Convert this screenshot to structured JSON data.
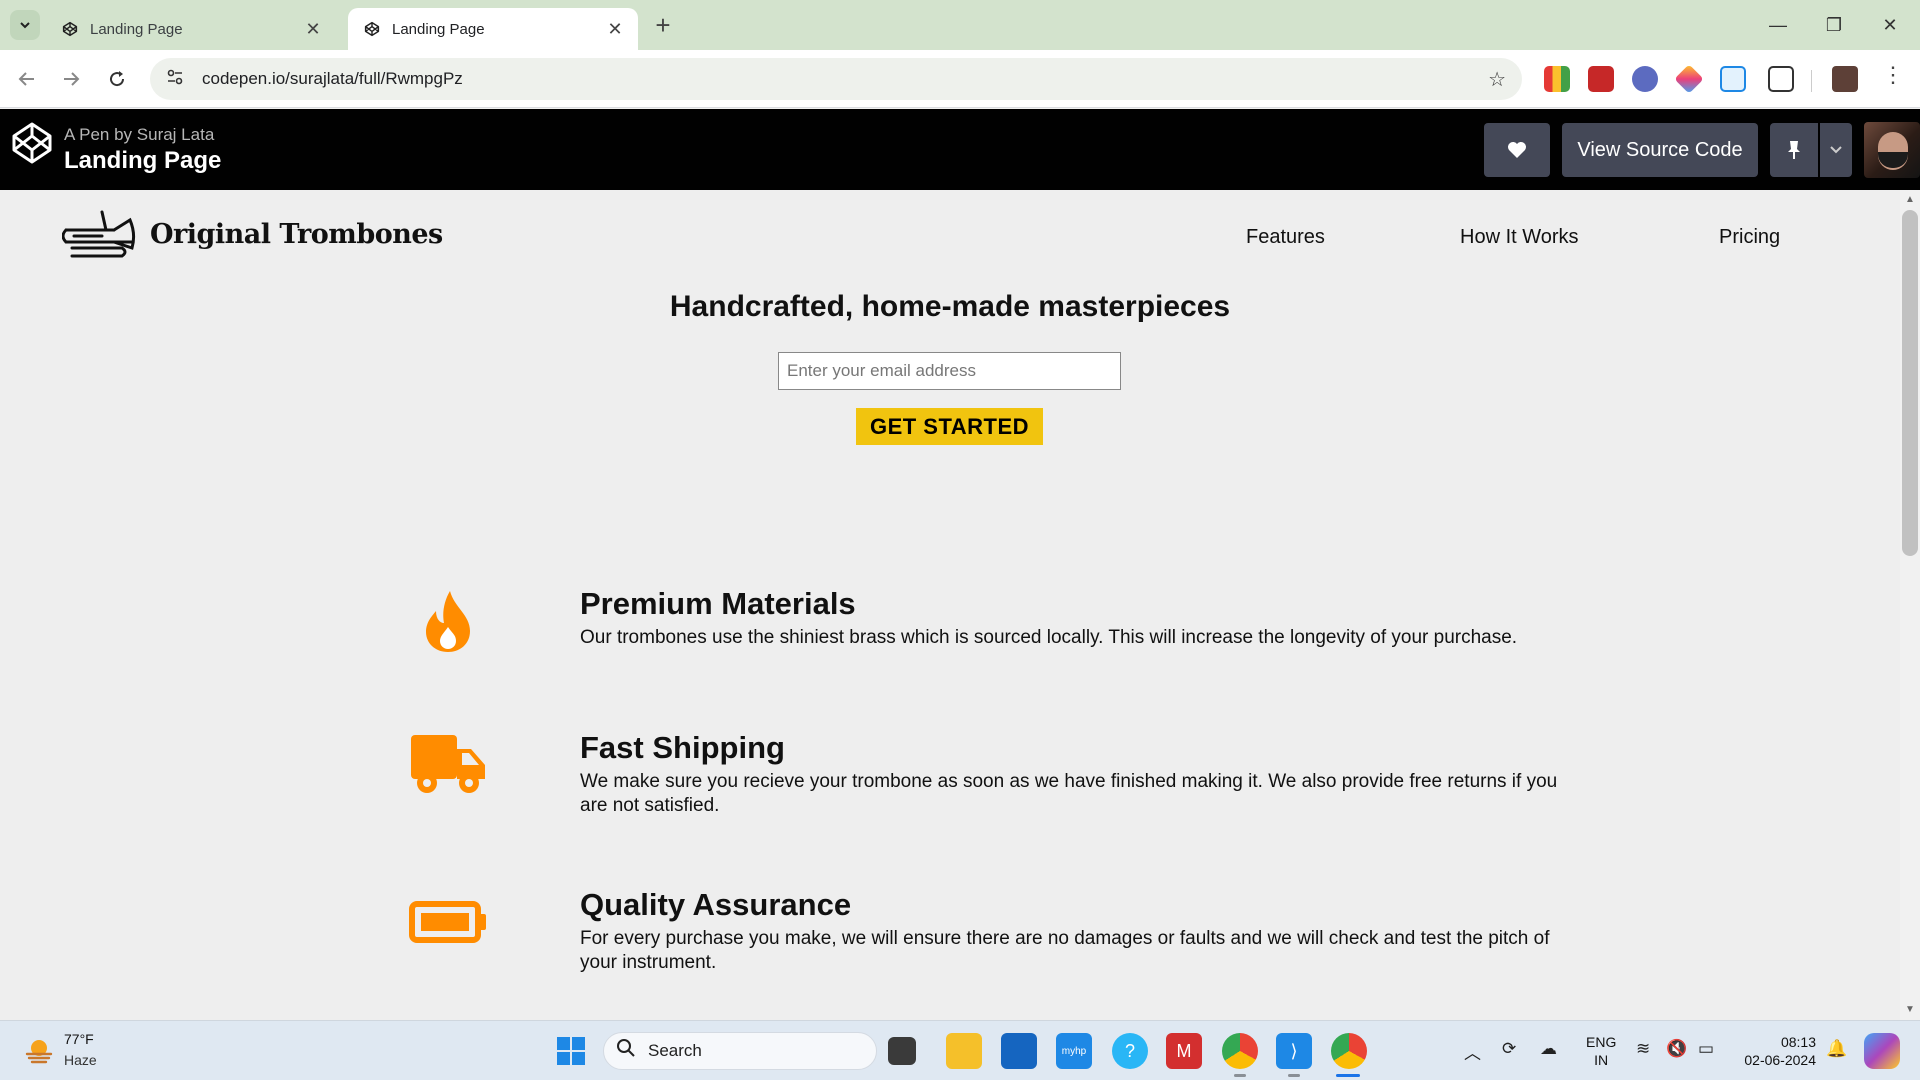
{
  "browser": {
    "tabs": [
      {
        "title": "Landing Page",
        "close": "✕"
      },
      {
        "title": "Landing Page",
        "close": "✕"
      }
    ],
    "new_tab": "+",
    "url": "codepen.io/surajlata/full/RwmpgPz",
    "window_controls": {
      "minimize": "—",
      "restore": "❐",
      "close": "✕"
    }
  },
  "codepen": {
    "byline": "A Pen by Suraj Lata",
    "title": "Landing Page",
    "view_source_label": "View Source Code",
    "heart_icon": "heart-icon",
    "pin_icon": "pin-icon"
  },
  "site": {
    "brand": "Original Trombones",
    "nav": [
      "Features",
      "How It Works",
      "Pricing"
    ],
    "hero_title": "Handcrafted, home-made masterpieces",
    "email_placeholder": "Enter your email address",
    "cta_label": "GET STARTED",
    "accent_color": "#f1c40f",
    "icon_color": "#ff8c00",
    "features": [
      {
        "icon": "fire-icon",
        "title": "Premium Materials",
        "text": "Our trombones use the shiniest brass which is sourced locally. This will increase the longevity of your purchase."
      },
      {
        "icon": "truck-icon",
        "title": "Fast Shipping",
        "text": "We make sure you recieve your trombone as soon as we have finished making it. We also provide free returns if you are not satisfied."
      },
      {
        "icon": "battery-icon",
        "title": "Quality Assurance",
        "text": "For every purchase you make, we will ensure there are no damages or faults and we will check and test the pitch of your instrument."
      }
    ]
  },
  "taskbar": {
    "weather_temp": "77°F",
    "weather_cond": "Haze",
    "search_label": "Search",
    "lang_top": "ENG",
    "lang_bottom": "IN",
    "time": "08:13",
    "date": "02-06-2024"
  }
}
